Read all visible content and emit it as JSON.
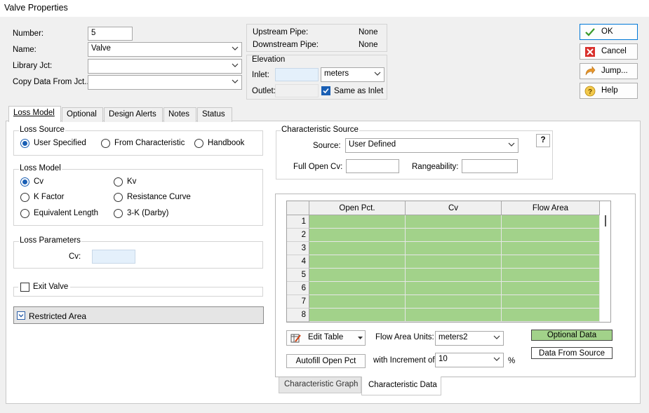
{
  "window": {
    "title": "Valve Properties"
  },
  "form": {
    "number_label": "Number:",
    "number_value": "5",
    "name_label": "Name:",
    "name_value": "Valve",
    "library_label": "Library Jct:",
    "library_value": "",
    "copy_label": "Copy Data From Jct...",
    "copy_value": ""
  },
  "pipes": {
    "upstream_label": "Upstream Pipe:",
    "upstream_value": "None",
    "downstream_label": "Downstream Pipe:",
    "downstream_value": "None"
  },
  "elevation": {
    "title": "Elevation",
    "inlet_label": "Inlet:",
    "inlet_value": "",
    "units_value": "meters",
    "outlet_label": "Outlet:",
    "outlet_value": "",
    "same_as_inlet_label": "Same as Inlet",
    "same_as_inlet_checked": true
  },
  "buttons": {
    "ok": "OK",
    "cancel": "Cancel",
    "jump": "Jump...",
    "help": "Help"
  },
  "tabs": [
    {
      "label": "Loss Model",
      "active": true
    },
    {
      "label": "Optional"
    },
    {
      "label": "Design Alerts"
    },
    {
      "label": "Notes"
    },
    {
      "label": "Status"
    }
  ],
  "loss_source": {
    "title": "Loss Source",
    "options": [
      "User Specified",
      "From Characteristic",
      "Handbook"
    ],
    "selected": 0
  },
  "loss_model": {
    "title": "Loss Model",
    "options": [
      "Cv",
      "Kv",
      "K Factor",
      "Resistance Curve",
      "Equivalent Length",
      "3-K (Darby)"
    ],
    "selected": 0
  },
  "loss_parameters": {
    "title": "Loss Parameters",
    "cv_label": "Cv:",
    "cv_value": ""
  },
  "exit_valve": {
    "label": "Exit Valve",
    "checked": false
  },
  "restricted_area": {
    "label": "Restricted Area"
  },
  "characteristic_source": {
    "title": "Characteristic Source",
    "source_label": "Source:",
    "source_value": "User Defined",
    "full_open_label": "Full Open Cv:",
    "full_open_value": "",
    "rangeability_label": "Rangeability:",
    "rangeability_value": "",
    "help_label": "?"
  },
  "table": {
    "columns": [
      "Open Pct.",
      "Cv",
      "Flow Area"
    ],
    "rows": [
      "1",
      "2",
      "3",
      "4",
      "5",
      "6",
      "7",
      "8"
    ],
    "cell_color": "#a2d28a"
  },
  "table_controls": {
    "edit_table_label": "Edit Table",
    "flow_area_units_label": "Flow Area Units:",
    "flow_area_units_value": "meters2",
    "optional_data_label": "Optional Data",
    "optional_data_color": "#a2d28a",
    "data_from_source_label": "Data From Source",
    "autofill_label": "Autofill Open Pct",
    "increment_label": "with Increment of",
    "increment_value": "10",
    "increment_unit": "%"
  },
  "bottom_tabs": [
    {
      "label": "Characteristic Graph"
    },
    {
      "label": "Characteristic Data",
      "active": true
    }
  ],
  "colors": {
    "accent": "#1a5fb4",
    "readonly_blue": "#e4f0fb"
  }
}
